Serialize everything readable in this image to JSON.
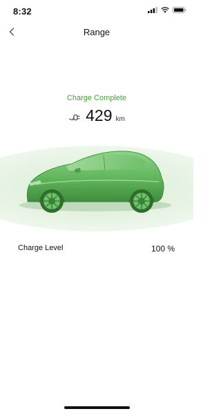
{
  "status_bar": {
    "time": "8:32"
  },
  "nav": {
    "title": "Range"
  },
  "charge": {
    "status": "Charge Complete",
    "range_value": "429",
    "range_unit": "km",
    "level_label": "Charge Level",
    "level_value": "100 %"
  },
  "colors": {
    "accent_green": "#4a9a3c",
    "glow": "#e6f3e3"
  },
  "icons": [
    "chevron-left-icon",
    "plug-icon",
    "signal-icon",
    "wifi-icon",
    "battery-icon"
  ]
}
